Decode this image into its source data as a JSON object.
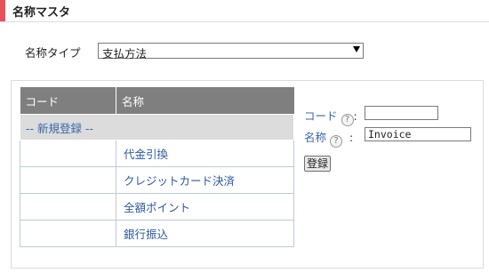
{
  "header": {
    "title": "名称マスタ",
    "accent_color": "#e8505b"
  },
  "type_selector": {
    "label": "名称タイプ",
    "selected": "支払方法"
  },
  "list": {
    "headers": {
      "code": "コード",
      "name": "名称"
    },
    "new_entry": "-- 新規登録 --",
    "rows": [
      {
        "code": "",
        "name": "代金引換"
      },
      {
        "code": "",
        "name": "クレジットカード決済"
      },
      {
        "code": "",
        "name": "全額ポイント"
      },
      {
        "code": "",
        "name": "銀行振込"
      }
    ]
  },
  "form": {
    "code_label": "コード",
    "code_value": "",
    "name_label": "名称",
    "name_value": "Invoice",
    "help_icon": "?",
    "colon": ":",
    "submit_label": "登録"
  }
}
